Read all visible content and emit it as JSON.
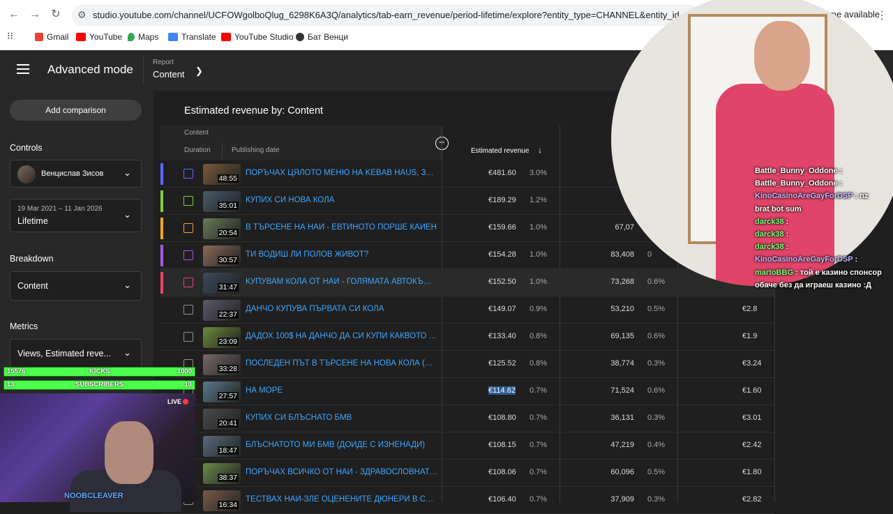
{
  "browser": {
    "url": "studio.youtube.com/channel/UCFOWgolboQlug_6298K6A3Q/analytics/tab-earn_revenue/period-lifetime/explore?entity_type=CHANNEL&entity_id=...",
    "chrome_available": "Chrome available",
    "bookmarks": [
      "Gmail",
      "YouTube",
      "Maps",
      "Translate",
      "YouTube Studio",
      "Бат Венци"
    ]
  },
  "header": {
    "mode": "Advanced mode",
    "report_label": "Report",
    "report_value": "Content"
  },
  "sidebar": {
    "add_comparison": "Add comparison",
    "controls_label": "Controls",
    "channel_name": "Венцислав Зисов",
    "date_range": "19 Mar 2021 – 11 Jan 2026",
    "period": "Lifetime",
    "breakdown_label": "Breakdown",
    "breakdown_value": "Content",
    "metrics_label": "Metrics",
    "metrics_value": "Views, Estimated reve..."
  },
  "table": {
    "title": "Estimated revenue by: Content",
    "col_content": "Content",
    "col_duration": "Duration",
    "col_published": "Publishing date",
    "col_revenue": "Estimated revenue",
    "rows": [
      {
        "dur": "48:55",
        "title": "ПОРЪЧАХ ЦЯЛОТО МЕНЮ НА KEBAB HAUS, ЗА ДА ...",
        "rev": "€481.60",
        "pct": "3.0%",
        "views": "",
        "vpct": "",
        "rpm": "",
        "color": "#5b6bff",
        "thumb": "#7a5a3a"
      },
      {
        "dur": "35:01",
        "title": "КУПИХ СИ НОВА КОЛА",
        "rev": "€189.29",
        "pct": "1.2%",
        "views": "75,",
        "vpct": "",
        "rpm": "",
        "color": "#7fd13b",
        "thumb": "#4a5a6a"
      },
      {
        "dur": "20:54",
        "title": "В ТЪРСЕНЕ НА НАЙ - ЕВТИНОТО ПОРШЕ КАЙЕН",
        "rev": "€159.66",
        "pct": "1.0%",
        "views": "67,07",
        "vpct": "",
        "rpm": "",
        "color": "#f0a431",
        "thumb": "#6a7a5a"
      },
      {
        "dur": "30:57",
        "title": "ТИ ВОДИШ ЛИ ПОЛОВ ЖИВОТ?",
        "rev": "€154.28",
        "pct": "1.0%",
        "views": "83,408",
        "vpct": "0",
        "rpm": "",
        "color": "#a559e8",
        "thumb": "#8a6a5a"
      },
      {
        "dur": "31:47",
        "title": "КУПУВАМ КОЛА ОТ НАЙ - ГОЛЯМАТА АВТОКЪЩА В...",
        "rev": "€152.50",
        "pct": "1.0%",
        "views": "73,268",
        "vpct": "0.6%",
        "rpm": "",
        "color": "#e8456a",
        "thumb": "#3a4a5a"
      },
      {
        "dur": "22:37",
        "title": "ДАНЧО КУПУВА ПЪРВАТА СИ КОЛА",
        "rev": "€149.07",
        "pct": "0.9%",
        "views": "53,210",
        "vpct": "0.5%",
        "rpm": "€2.8",
        "color": "",
        "thumb": "#5a5a6a"
      },
      {
        "dur": "23:09",
        "title": "ДАДОХ 100$ НА ДАНЧО ДА СИ КУПИ КАКВОТО ИС...",
        "rev": "€133.40",
        "pct": "0.8%",
        "views": "69,135",
        "vpct": "0.6%",
        "rpm": "€1.9",
        "color": "",
        "thumb": "#6a8a3a"
      },
      {
        "dur": "33:28",
        "title": "ПОСЛЕДЕН ПЪТ В ТЪРСЕНЕ НА НОВА КОЛА (НЕ Е К...",
        "rev": "€125.52",
        "pct": "0.8%",
        "views": "38,774",
        "vpct": "0.3%",
        "rpm": "€3.24",
        "color": "",
        "thumb": "#7a6a6a"
      },
      {
        "dur": "27:57",
        "title": "НА МОРЕ",
        "rev": "€114.62",
        "pct": "0.7%",
        "views": "71,524",
        "vpct": "0.6%",
        "rpm": "€1.60",
        "color": "",
        "thumb": "#5a7a8a"
      },
      {
        "dur": "20:41",
        "title": "КУПИХ СИ БЛЪСНАТО БМВ",
        "rev": "€108.80",
        "pct": "0.7%",
        "views": "36,131",
        "vpct": "0.3%",
        "rpm": "€3.01",
        "color": "",
        "thumb": "#4a4a4a"
      },
      {
        "dur": "18:47",
        "title": "БЛЪСНАТОТО МИ БМВ (ДОЙДЕ С ИЗНЕНАДИ)",
        "rev": "€108.15",
        "pct": "0.7%",
        "views": "47,219",
        "vpct": "0.4%",
        "rpm": "€2.42",
        "color": "",
        "thumb": "#5a6a7a"
      },
      {
        "dur": "38:37",
        "title": "ПОРЪЧАХ ВСИЧКО ОТ НАЙ - ЗДРАВОСЛОВНАТА КУ...",
        "rev": "€108.06",
        "pct": "0.7%",
        "views": "60,096",
        "vpct": "0.5%",
        "rpm": "€1.80",
        "color": "",
        "thumb": "#6a8a4a"
      },
      {
        "dur": "16:34",
        "title": "ТЕСТВАХ НАЙ-ЗЛЕ ОЦЕНЕНИТЕ ДЮНЕРИ В СОФИЯ",
        "rev": "€106.40",
        "pct": "0.7%",
        "views": "37,909",
        "vpct": "0.3%",
        "rpm": "€2.82",
        "color": "",
        "thumb": "#7a5a4a"
      }
    ]
  },
  "overlay": {
    "kicks_left": "15576",
    "kicks_label": "KICKS",
    "kicks_right": "1000",
    "subs_left": "13",
    "subs_label": "SUBSCRIBERS",
    "subs_right": "10",
    "live": "LIVE",
    "nick": "NOOBCLEAVER",
    "chat": [
      {
        "user": "Battle_Bunny_Oddone",
        "msg": "",
        "cls": "u1"
      },
      {
        "user": "Battle_Bunny_Oddone",
        "msg": "",
        "cls": "u1"
      },
      {
        "user": "KinoCasinoAreGayForDSP",
        "msg": "nz brat bot sum",
        "cls": "u2"
      },
      {
        "user": "darck38",
        "msg": "",
        "cls": "u3"
      },
      {
        "user": "darck38",
        "msg": "",
        "cls": "u3"
      },
      {
        "user": "darck38",
        "msg": "",
        "cls": "u3"
      },
      {
        "user": "KinoCasinoAreGayForDSP",
        "msg": "",
        "cls": "u2"
      },
      {
        "user": "martoBBG",
        "msg": "той е казино спонсор обаче без да играеш казино :Д",
        "cls": "u3"
      }
    ]
  }
}
